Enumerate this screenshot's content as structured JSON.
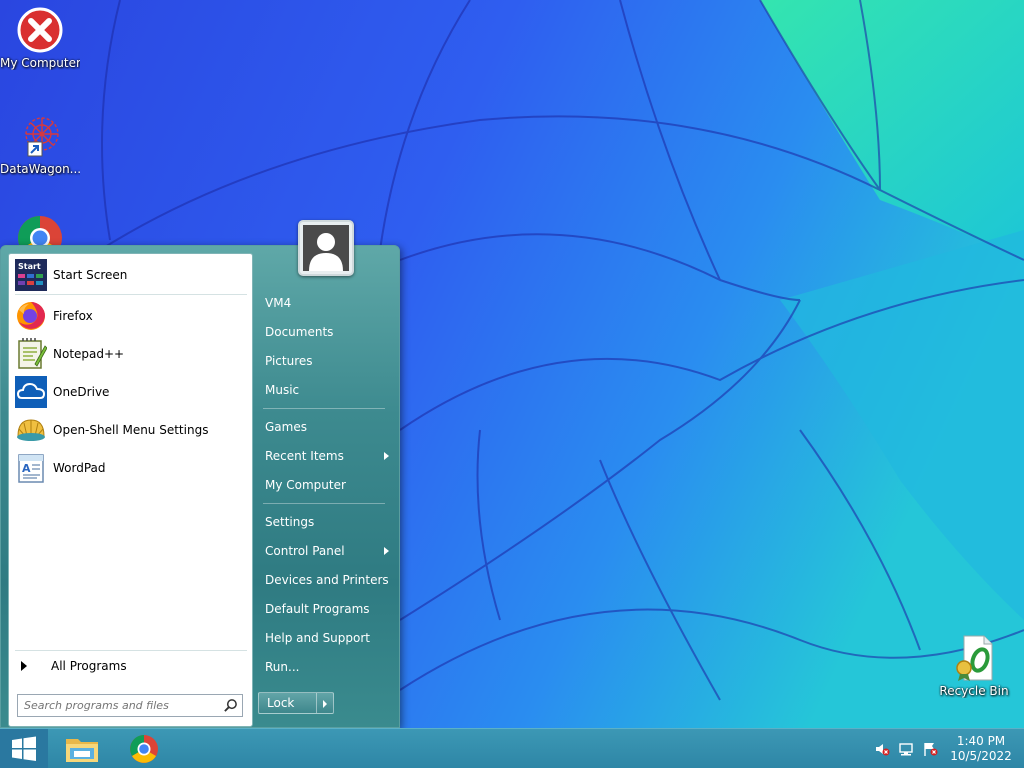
{
  "desktop": {
    "icons": [
      {
        "label": "My Computer"
      },
      {
        "label": "DataWagon..."
      },
      {
        "label": "Recycle Bin"
      }
    ]
  },
  "start_menu": {
    "programs": [
      {
        "label": "Start Screen",
        "icon": "start-screen-icon"
      },
      {
        "label": "Firefox",
        "icon": "firefox-icon"
      },
      {
        "label": "Notepad++",
        "icon": "notepad-plus-plus-icon"
      },
      {
        "label": "OneDrive",
        "icon": "onedrive-icon"
      },
      {
        "label": "Open-Shell Menu Settings",
        "icon": "open-shell-icon"
      },
      {
        "label": "WordPad",
        "icon": "wordpad-icon"
      }
    ],
    "all_programs_label": "All Programs",
    "search_placeholder": "Search programs and files",
    "right_items": [
      {
        "label": "VM4"
      },
      {
        "label": "Documents"
      },
      {
        "label": "Pictures"
      },
      {
        "label": "Music"
      },
      {
        "label": "Games"
      },
      {
        "label": "Recent Items",
        "submenu": true
      },
      {
        "label": "My Computer"
      },
      {
        "label": "Settings"
      },
      {
        "label": "Control Panel",
        "submenu": true
      },
      {
        "label": "Devices and Printers"
      },
      {
        "label": "Default Programs"
      },
      {
        "label": "Help and Support"
      },
      {
        "label": "Run..."
      }
    ],
    "lock_label": "Lock"
  },
  "taskbar": {
    "pinned": [
      "file-explorer-icon",
      "chrome-icon"
    ],
    "tray": [
      "volume-muted-icon",
      "network-icon",
      "action-center-icon"
    ],
    "time": "1:40 PM",
    "date": "10/5/2022"
  },
  "colors": {
    "wallpaper_blue": "#2d55e6",
    "wallpaper_teal": "#19c9d0",
    "menu_teal": "#3d8a8f",
    "taskbar": "#3393b2"
  }
}
